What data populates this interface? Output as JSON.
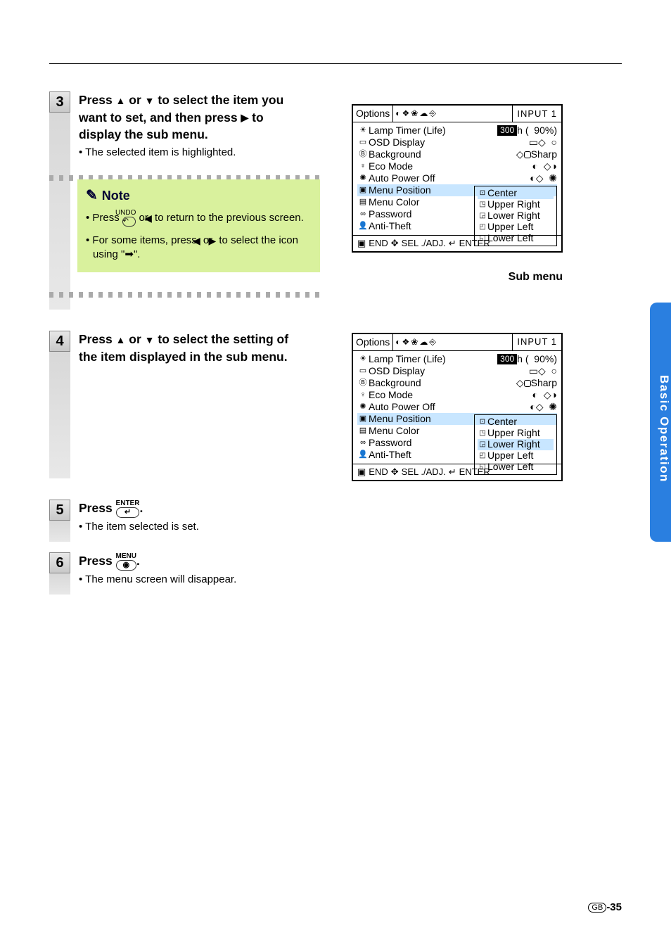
{
  "sideTab": "Basic Operation",
  "pageLabel": {
    "region": "GB",
    "num": "-35"
  },
  "steps": {
    "s3": {
      "num": "3",
      "title_p1": "Press ",
      "title_p2": " or ",
      "title_p3": " to select the item you want to set, and then press ",
      "title_p4": " to display the sub menu.",
      "sub": "The selected item is highlighted."
    },
    "s4": {
      "num": "4",
      "title_p1": "Press ",
      "title_p2": " or ",
      "title_p3": " to select the setting of the item displayed in the sub menu."
    },
    "s5": {
      "num": "5",
      "title": "Press ",
      "keytop": "ENTER",
      "keysym": "↵",
      "tail": ".",
      "sub": "The item selected is set."
    },
    "s6": {
      "num": "6",
      "title": "Press ",
      "keytop": "MENU",
      "keysym": "◉",
      "tail": ".",
      "sub": "The menu screen will disappear."
    }
  },
  "note": {
    "heading": "Note",
    "b1_p1": "Press ",
    "b1_keytop": "UNDO",
    "b1_keysym": "↶",
    "b1_p2": " or ",
    "b1_p3": " to return to the previous screen.",
    "b2_p1": "For some items, press ",
    "b2_p2": " or ",
    "b2_p3": " to select the icon using \"",
    "b2_p4": "\"."
  },
  "osd": {
    "title": "Options",
    "input": "INPUT  1",
    "rows": [
      "Lamp Timer  (Life)",
      "OSD Display",
      "Background",
      "Eco Mode",
      "Auto Power Off",
      "Menu Position",
      "Menu Color",
      "Password",
      "Anti-Theft"
    ],
    "lampHours": "300",
    "lampPct": "90%",
    "bgValue": "Sharp",
    "subItems": [
      "Center",
      "Upper Right",
      "Lower Right",
      "Upper Left",
      "Lower Left"
    ],
    "footer": {
      "end": "END",
      "sel": "SEL ./ADJ.",
      "enter": "ENTER"
    },
    "submenuCaption": "Sub menu"
  },
  "osd2_highlightSub": "Lower Right"
}
